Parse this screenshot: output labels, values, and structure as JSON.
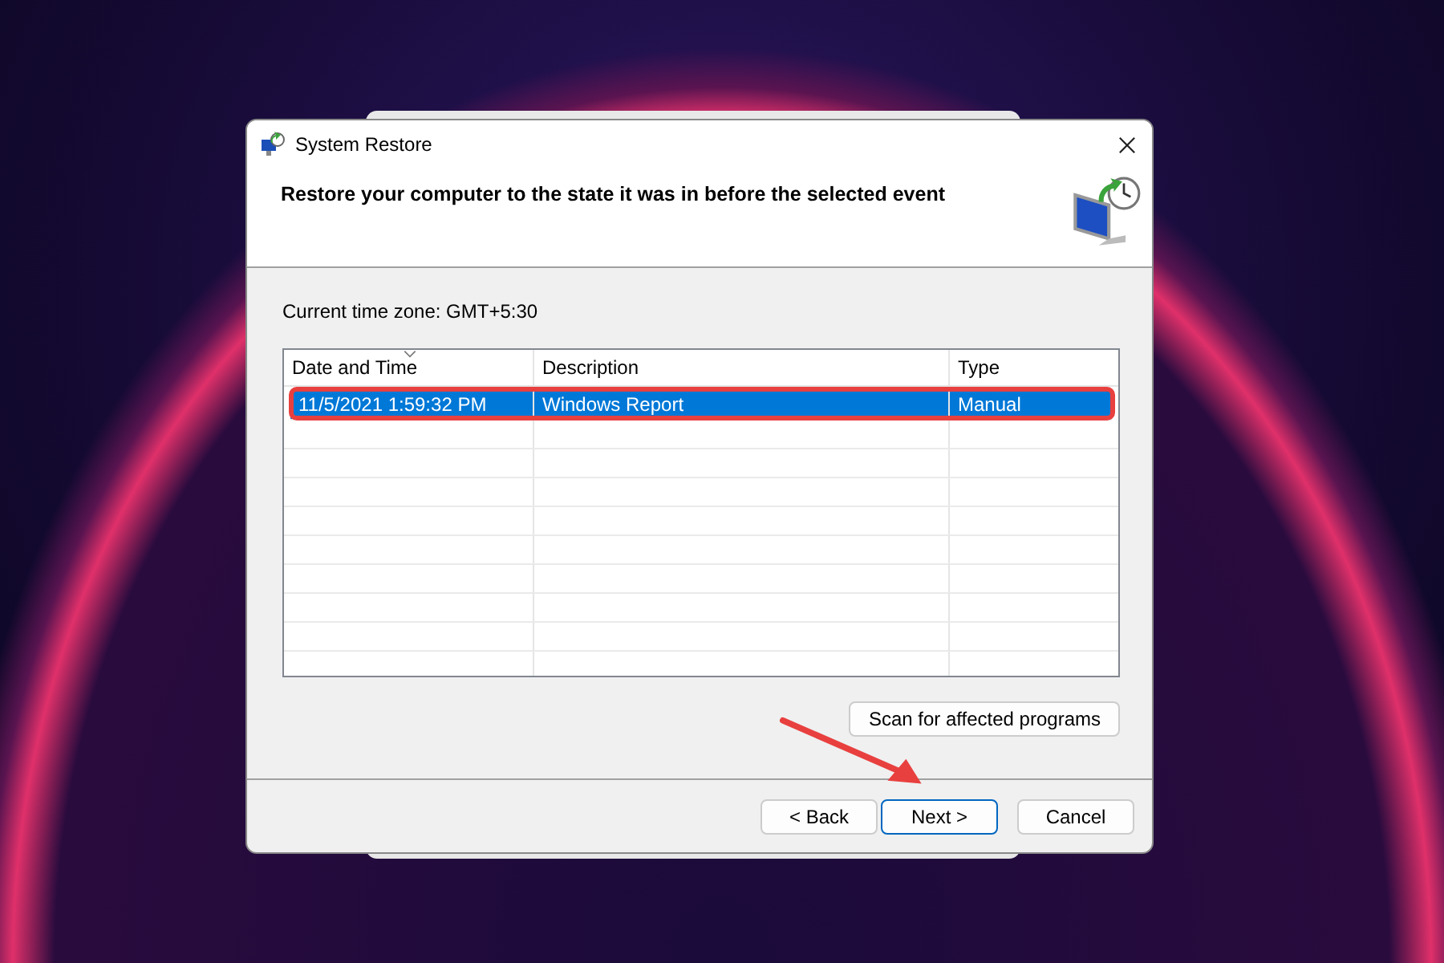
{
  "window": {
    "title": "System Restore"
  },
  "heading": "Restore your computer to the state it was in before the selected event",
  "time_zone": "Current time zone: GMT+5:30",
  "table": {
    "columns": [
      "Date and Time",
      "Description",
      "Type"
    ],
    "rows": [
      {
        "cells": [
          "11/5/2021 1:59:32 PM",
          "Windows Report",
          "Manual"
        ],
        "selected": true
      }
    ]
  },
  "scan_button": "Scan for affected programs",
  "buttons": [
    {
      "label": "< Back",
      "default": false
    },
    {
      "label": "Next >",
      "default": true
    },
    {
      "label": "Cancel",
      "default": false
    }
  ]
}
